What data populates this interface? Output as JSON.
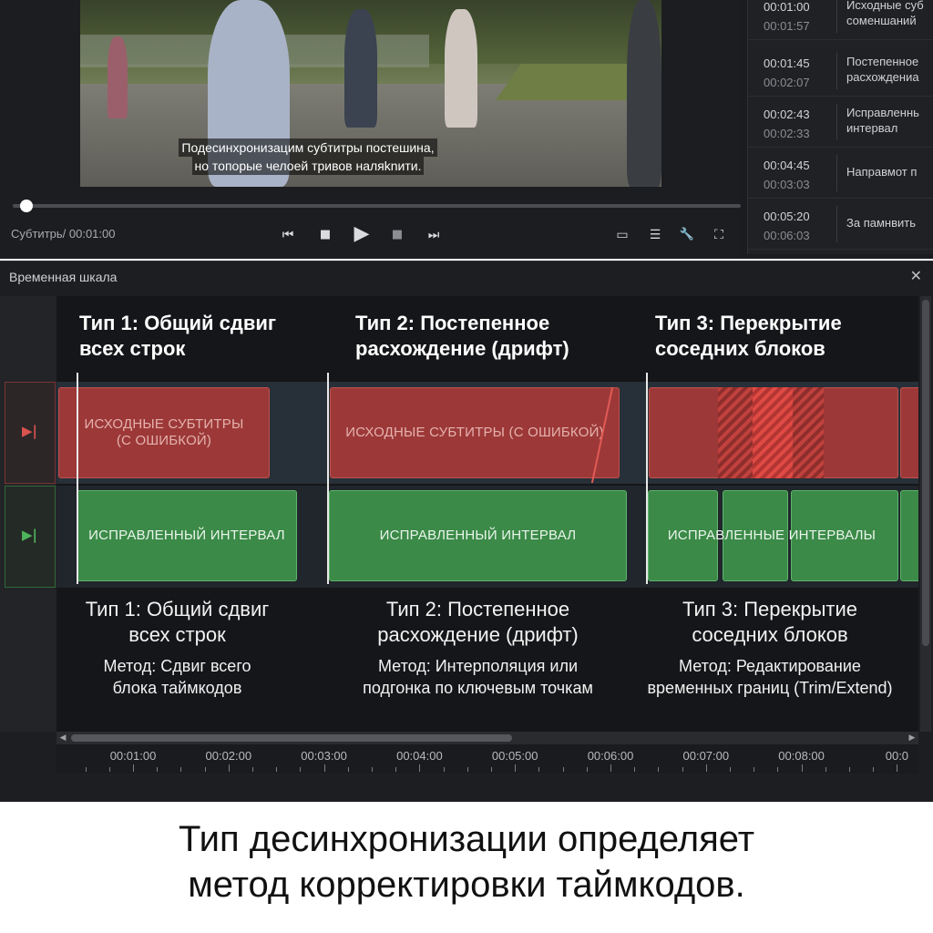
{
  "player": {
    "subtitle_line1": "Подесинхронизацим субтитры постешина,",
    "subtitle_line2": "но топорые челоей тривов наляknити.",
    "status_label": "Субтитрь/ 00:01:00",
    "progress": 0.01
  },
  "subtitle_list": [
    {
      "start": "00:01:00",
      "end": "00:01:57",
      "text": "Исходные суб\nсоменшаний"
    },
    {
      "start": "00:01:45",
      "end": "00:02:07",
      "text": "Постепенное\nрасхождениа"
    },
    {
      "start": "00:02:43",
      "end": "00:02:33",
      "text": "Исправленнь\nинтервал"
    },
    {
      "start": "00:04:45",
      "end": "00:03:03",
      "text": "Направмот п"
    },
    {
      "start": "00:05:20",
      "end": "00:06:03",
      "text": "За памнвить"
    }
  ],
  "timeline": {
    "title": "Временная шкала",
    "columns": [
      {
        "title_line1": "Тип 1: Общий сдвиг",
        "title_line2": "всех строк",
        "red_label": "ИСХОДНЫЕ СУБТИТРЫ\n(С ОШИБКОЙ)",
        "green_label": "ИСПРАВЛЕННЫЙ ИНТЕРВАЛ",
        "desc_line1": "Тип 1: Общий сдвиг",
        "desc_line2": "всех строк",
        "method_line1": "Метод: Сдвиг всего",
        "method_line2": "блока таймкодов"
      },
      {
        "title_line1": "Тип 2: Постепенное",
        "title_line2": "расхождение (дрифт)",
        "red_label": "ИСХОДНЫЕ СУБТИТРЫ (С ОШИБКОЙ)",
        "green_label": "ИСПРАВЛЕННЫЙ ИНТЕРВАЛ",
        "desc_line1": "Тип 2: Постепенное",
        "desc_line2": "расхождение (дрифт)",
        "method_line1": "Метод: Интерполяция или",
        "method_line2": "подгонка по ключевым точкам"
      },
      {
        "title_line1": "Тип 3: Перекрытие",
        "title_line2": "соседних блоков",
        "red_label": "",
        "green_label": "ИСПРАВЛЕННЫЕ ИНТЕРВАЛЫ",
        "desc_line1": "Тип 3: Перекрытие",
        "desc_line2": "соседних блоков",
        "method_line1": "Метод: Редактирование",
        "method_line2": "временных границ (Trim/Extend)"
      }
    ],
    "ruler": [
      "00:01:00",
      "00:02:00",
      "00:03:00",
      "00:04:00",
      "00:05:00",
      "00:06:00",
      "00:07:00",
      "00:08:00",
      "00:0"
    ]
  },
  "icons": {
    "skip_back": "⏮",
    "stop": "■",
    "play": "▶",
    "stop2": "■",
    "skip_forward": "⏭",
    "subtitle": "▭",
    "align": "☰",
    "wrench": "🔧",
    "fullscreen": "⛶",
    "track_red": "▶|",
    "track_green": "▶|",
    "close": "✕"
  },
  "colors": {
    "red_track": "#a33a38",
    "green_track": "#3b8a48"
  },
  "caption": {
    "line1": "Тип десинхронизации определяет",
    "line2": "метод корректировки таймкодов."
  }
}
